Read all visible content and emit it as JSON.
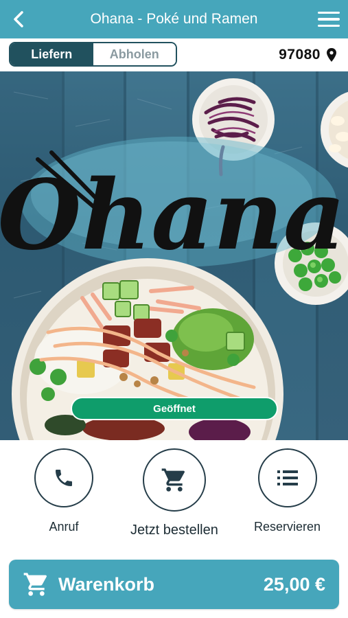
{
  "header": {
    "title": "Ohana - Poké und Ramen",
    "back_icon": "chevron-left-icon",
    "menu_icon": "hamburger-menu-icon"
  },
  "mode": {
    "options": [
      {
        "label": "Liefern",
        "active": true
      },
      {
        "label": "Abholen",
        "active": false
      }
    ],
    "postcode": "97080",
    "postcode_icon": "map-pin-icon"
  },
  "hero": {
    "logo_text": "Ohana",
    "status": "Geöffnet"
  },
  "actions": [
    {
      "label": "Anruf",
      "icon": "phone-icon"
    },
    {
      "label": "Jetzt bestellen",
      "icon": "cart-icon"
    },
    {
      "label": "Reservieren",
      "icon": "list-icon"
    }
  ],
  "cart": {
    "label": "Warenkorb",
    "total": "25,00 €",
    "icon": "cart-icon"
  },
  "colors": {
    "primary": "#46a6bb",
    "dark_teal": "#21515e",
    "status_green": "#0f9d6b"
  }
}
